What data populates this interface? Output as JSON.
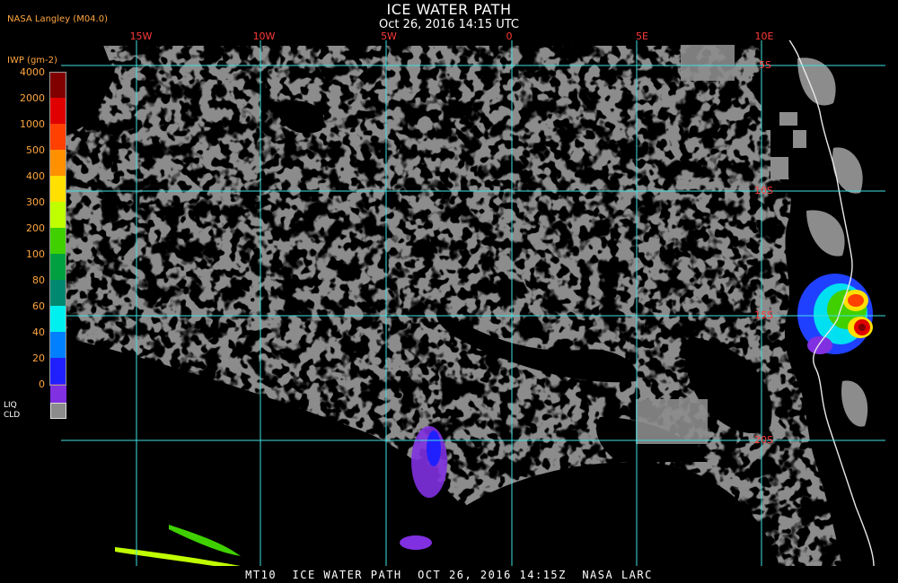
{
  "title": "ICE WATER PATH",
  "datetime": "Oct 26, 2016 14:15 UTC",
  "organization": "NASA Langley (M04.0)",
  "footer": "MT10  ICE WATER PATH  OCT 26, 2016 14:15Z  NASA LARC",
  "colors": {
    "background": "#000000",
    "cloud_liquid": "#8c8c8c",
    "grid": "#40e0e0",
    "coastline": "#e8e8e8",
    "label": "#ff3a3a",
    "legend_text": "#ffa640"
  },
  "longitude_labels": [
    "15W",
    "10W",
    "5W",
    "0",
    "5E",
    "10E"
  ],
  "latitude_labels": [
    "5S",
    "10S",
    "15S",
    "20S"
  ],
  "legend": {
    "title": "IWP (gm-2)",
    "levels": [
      {
        "label": "4000",
        "color": "#800000"
      },
      {
        "label": "2000",
        "color": "#e00000"
      },
      {
        "label": "1000",
        "color": "#ff4000"
      },
      {
        "label": "500",
        "color": "#ff9000"
      },
      {
        "label": "400",
        "color": "#ffe000"
      },
      {
        "label": "300",
        "color": "#c0ff00"
      },
      {
        "label": "200",
        "color": "#40d000"
      },
      {
        "label": "100",
        "color": "#00a040"
      },
      {
        "label": "80",
        "color": "#008870"
      },
      {
        "label": "60",
        "color": "#00f0f0"
      },
      {
        "label": "40",
        "color": "#0080ff"
      },
      {
        "label": "20",
        "color": "#2020ff"
      },
      {
        "label": "0",
        "color": "#8030e0"
      }
    ],
    "liquid_label_1": "LIQ",
    "liquid_label_2": "CLD"
  }
}
